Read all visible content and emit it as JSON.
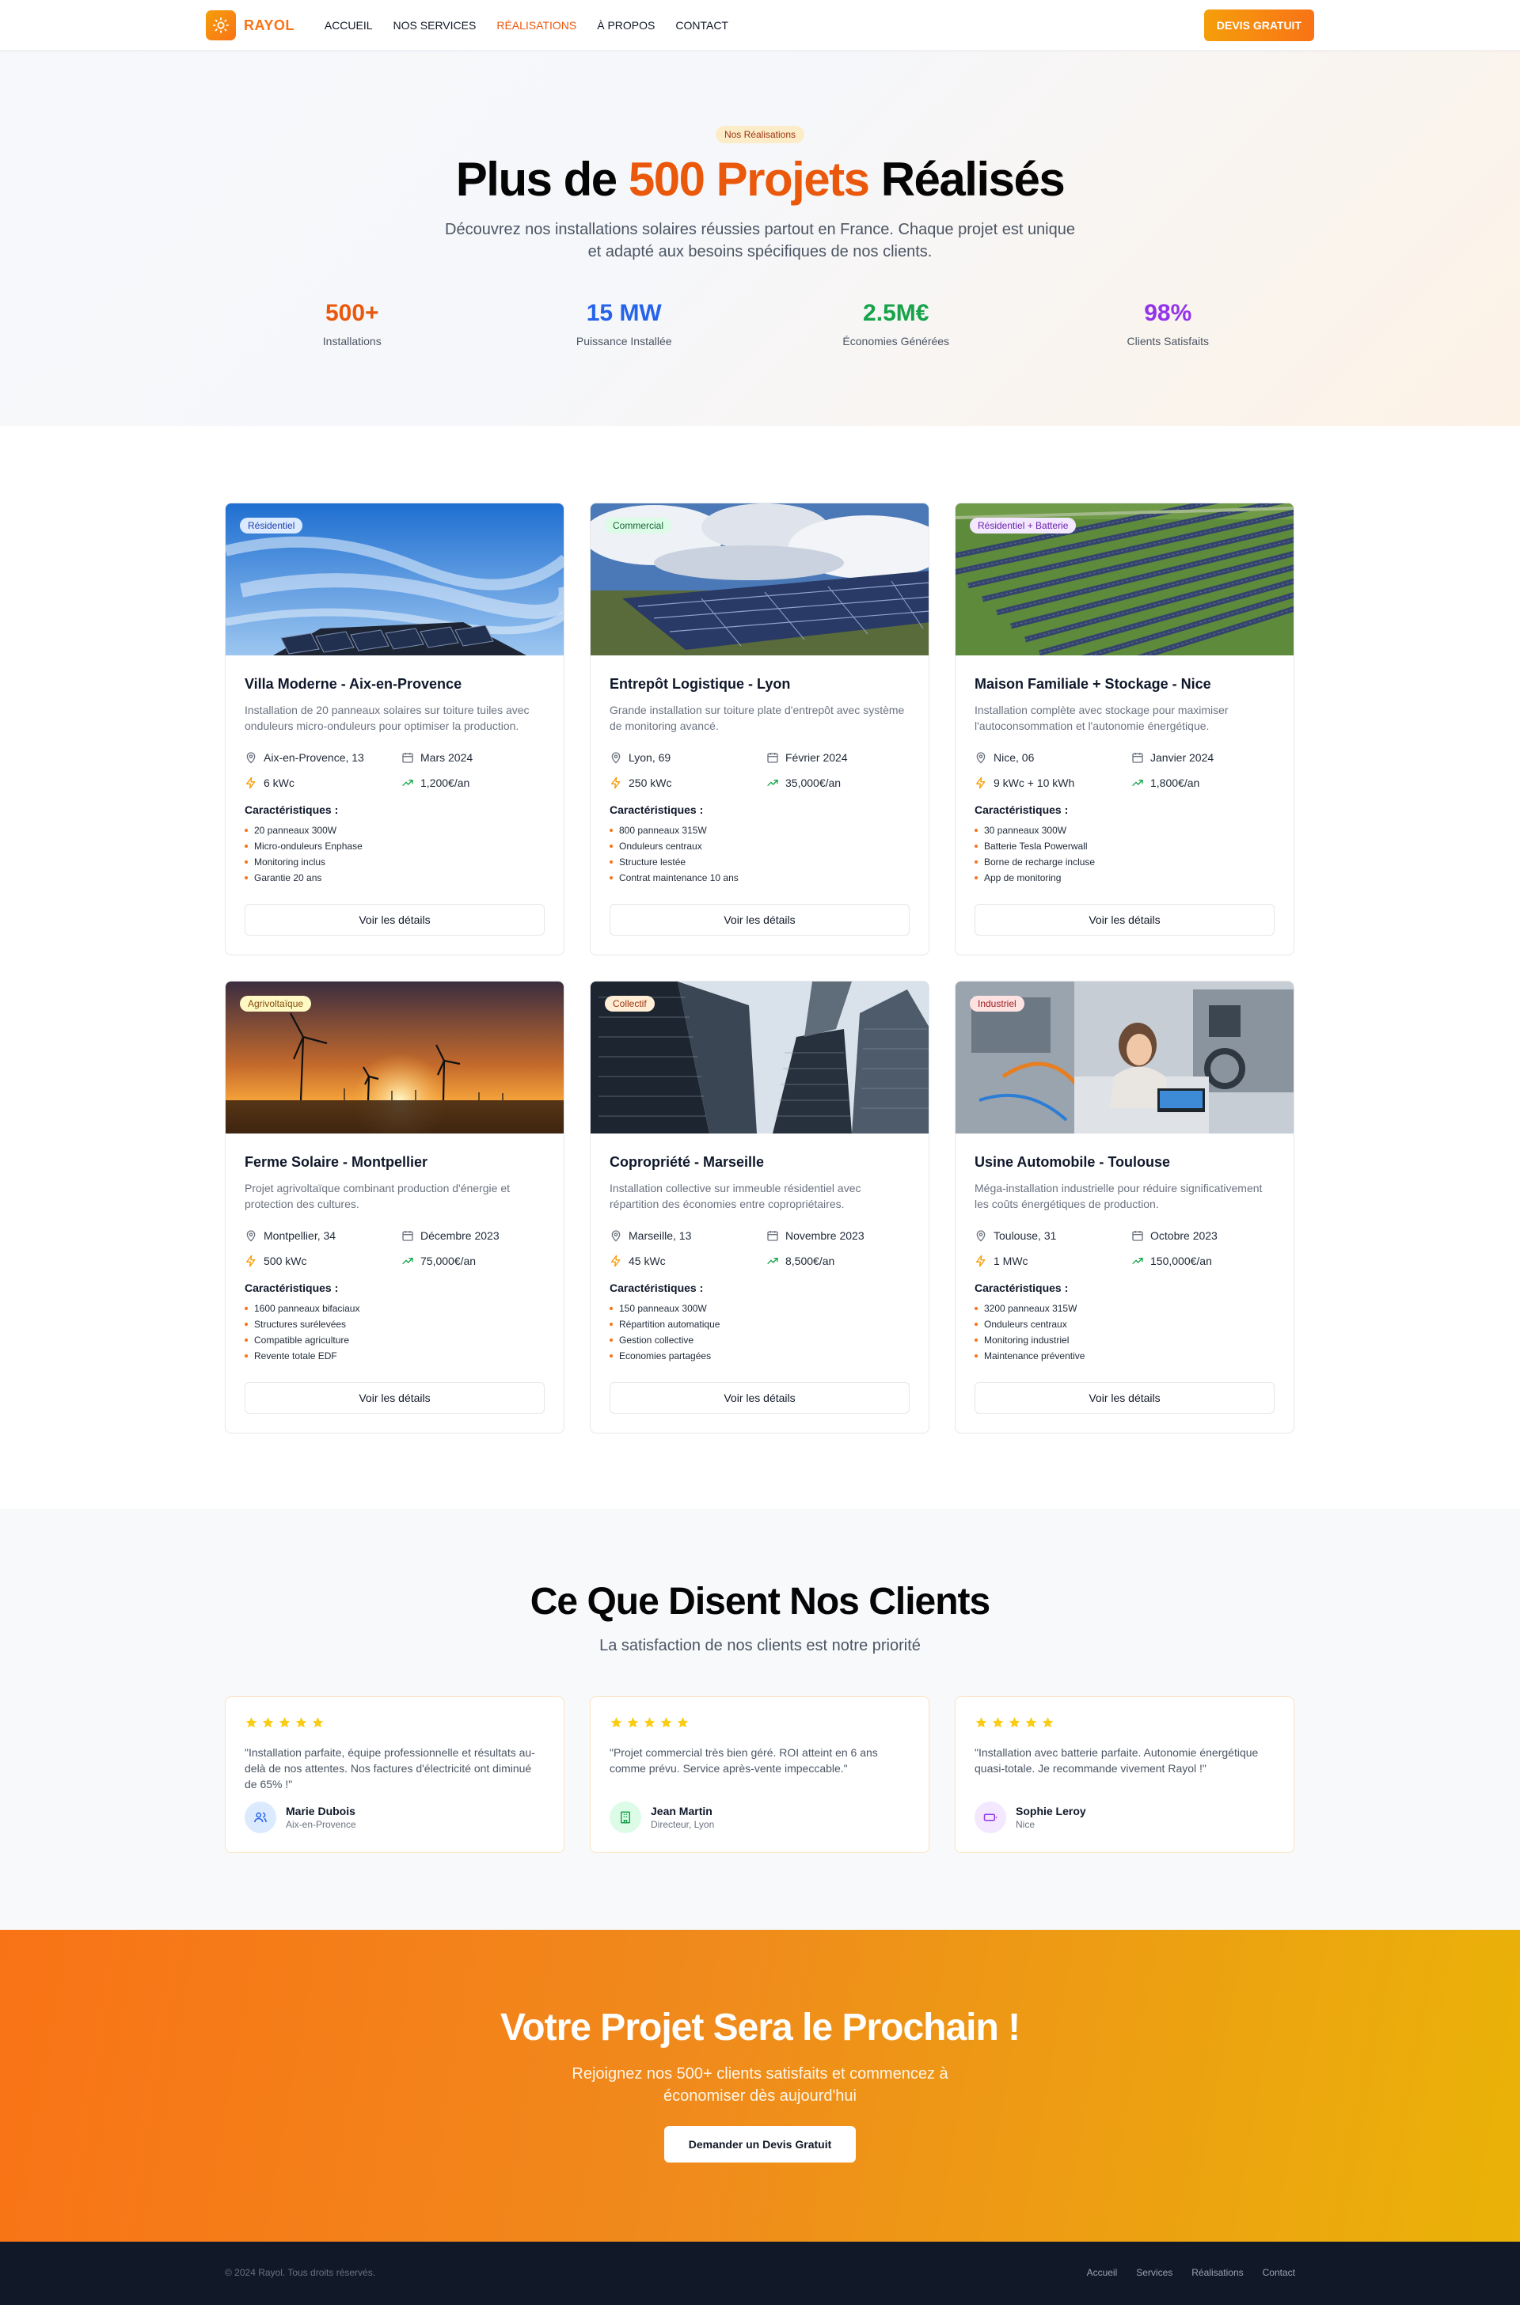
{
  "brand": {
    "name": "RAYOL",
    "accent": "#f97316"
  },
  "nav": {
    "links": [
      "ACCUEIL",
      "NOS SERVICES",
      "RÉALISATIONS",
      "À PROPOS",
      "CONTACT"
    ],
    "active_index": 2,
    "cta": "DEVIS GRATUIT"
  },
  "hero": {
    "badge": "Nos Réalisations",
    "title_before": "Plus de ",
    "title_highlight": "500 Projets",
    "title_after": " Réalisés",
    "subtitle": "Découvrez nos installations solaires réussies partout en France. Chaque projet est unique et adapté aux besoins spécifiques de nos clients.",
    "stats": [
      {
        "value": "500+",
        "label": "Installations",
        "color": "#ea580c"
      },
      {
        "value": "15 MW",
        "label": "Puissance Installée",
        "color": "#2563eb"
      },
      {
        "value": "2.5M€",
        "label": "Économies Générées",
        "color": "#16a34a"
      },
      {
        "value": "98%",
        "label": "Clients Satisfaits",
        "color": "#9333ea"
      }
    ]
  },
  "projects": [
    {
      "badge": "Résidentiel",
      "badge_bg": "#dbeafe",
      "badge_color": "#1e40af",
      "image": "solar-rooftop-sky",
      "title": "Villa Moderne - Aix-en-Provence",
      "description": "Installation de 20 panneaux solaires sur toiture tuiles avec onduleurs micro-onduleurs pour optimiser la production.",
      "location": "Aix-en-Provence, 13",
      "date": "Mars 2024",
      "power": "6 kWc",
      "savings": "1,200€/an",
      "features_title": "Caractéristiques :",
      "features": [
        "20 panneaux 300W",
        "Micro-onduleurs Enphase",
        "Monitoring inclus",
        "Garantie 20 ans"
      ],
      "button": "Voir les détails"
    },
    {
      "badge": "Commercial",
      "badge_bg": "#dcfce7",
      "badge_color": "#166534",
      "image": "solar-field-clouds",
      "title": "Entrepôt Logistique - Lyon",
      "description": "Grande installation sur toiture plate d'entrepôt avec système de monitoring avancé.",
      "location": "Lyon, 69",
      "date": "Février 2024",
      "power": "250 kWc",
      "savings": "35,000€/an",
      "features_title": "Caractéristiques :",
      "features": [
        "800 panneaux 315W",
        "Onduleurs centraux",
        "Structure lestée",
        "Contrat maintenance 10 ans"
      ],
      "button": "Voir les détails"
    },
    {
      "badge": "Résidentiel + Batterie",
      "badge_bg": "#f3e8ff",
      "badge_color": "#6b21a8",
      "image": "solar-farm-aerial",
      "title": "Maison Familiale + Stockage - Nice",
      "description": "Installation complète avec stockage pour maximiser l'autoconsommation et l'autonomie énergétique.",
      "location": "Nice, 06",
      "date": "Janvier 2024",
      "power": "9 kWc + 10 kWh",
      "savings": "1,800€/an",
      "features_title": "Caractéristiques :",
      "features": [
        "30 panneaux 300W",
        "Batterie Tesla Powerwall",
        "Borne de recharge incluse",
        "App de monitoring"
      ],
      "button": "Voir les détails"
    },
    {
      "badge": "Agrivoltaïque",
      "badge_bg": "#fef9c3",
      "badge_color": "#854d0e",
      "image": "wind-turbines-sunset",
      "title": "Ferme Solaire - Montpellier",
      "description": "Projet agrivoltaïque combinant production d'énergie et protection des cultures.",
      "location": "Montpellier, 34",
      "date": "Décembre 2023",
      "power": "500 kWc",
      "savings": "75,000€/an",
      "features_title": "Caractéristiques :",
      "features": [
        "1600 panneaux bifaciaux",
        "Structures surélevées",
        "Compatible agriculture",
        "Revente totale EDF"
      ],
      "button": "Voir les détails"
    },
    {
      "badge": "Collectif",
      "badge_bg": "#ffedd5",
      "badge_color": "#9a3412",
      "image": "skyscrapers",
      "title": "Copropriété - Marseille",
      "description": "Installation collective sur immeuble résidentiel avec répartition des économies entre copropriétaires.",
      "location": "Marseille, 13",
      "date": "Novembre 2023",
      "power": "45 kWc",
      "savings": "8,500€/an",
      "features_title": "Caractéristiques :",
      "features": [
        "150 panneaux 300W",
        "Répartition automatique",
        "Gestion collective",
        "Economies partagées"
      ],
      "button": "Voir les détails"
    },
    {
      "badge": "Industriel",
      "badge_bg": "#fee2e2",
      "badge_color": "#991b1b",
      "image": "factory-engineer",
      "title": "Usine Automobile - Toulouse",
      "description": "Méga-installation industrielle pour réduire significativement les coûts énergétiques de production.",
      "location": "Toulouse, 31",
      "date": "Octobre 2023",
      "power": "1 MWc",
      "savings": "150,000€/an",
      "features_title": "Caractéristiques :",
      "features": [
        "3200 panneaux 315W",
        "Onduleurs centraux",
        "Monitoring industriel",
        "Maintenance préventive"
      ],
      "button": "Voir les détails"
    }
  ],
  "testimonials": {
    "title": "Ce Que Disent Nos Clients",
    "subtitle": "La satisfaction de nos clients est notre priorité",
    "items": [
      {
        "rating": 5,
        "quote": "\"Installation parfaite, équipe professionnelle et résultats au-delà de nos attentes. Nos factures d'électricité ont diminué de 65% !\"",
        "name": "Marie Dubois",
        "role": "Aix-en-Provence",
        "avatar_icon": "users-icon",
        "avatar_bg": "#dbeafe",
        "avatar_color": "#2563eb"
      },
      {
        "rating": 5,
        "quote": "\"Projet commercial très bien géré. ROI atteint en 6 ans comme prévu. Service après-vente impeccable.\"",
        "name": "Jean Martin",
        "role": "Directeur, Lyon",
        "avatar_icon": "building-icon",
        "avatar_bg": "#dcfce7",
        "avatar_color": "#16a34a"
      },
      {
        "rating": 5,
        "quote": "\"Installation avec batterie parfaite. Autonomie énergétique quasi-totale. Je recommande vivement Rayol !\"",
        "name": "Sophie Leroy",
        "role": "Nice",
        "avatar_icon": "battery-icon",
        "avatar_bg": "#f3e8ff",
        "avatar_color": "#9333ea"
      }
    ]
  },
  "cta": {
    "title": "Votre Projet Sera le Prochain !",
    "subtitle": "Rejoignez nos 500+ clients satisfaits et commencez à économiser dès aujourd'hui",
    "button": "Demander un Devis Gratuit"
  },
  "footer": {
    "copyright": "© 2024 Rayol. Tous droits réservés.",
    "links": [
      "Accueil",
      "Services",
      "Réalisations",
      "Contact"
    ]
  }
}
